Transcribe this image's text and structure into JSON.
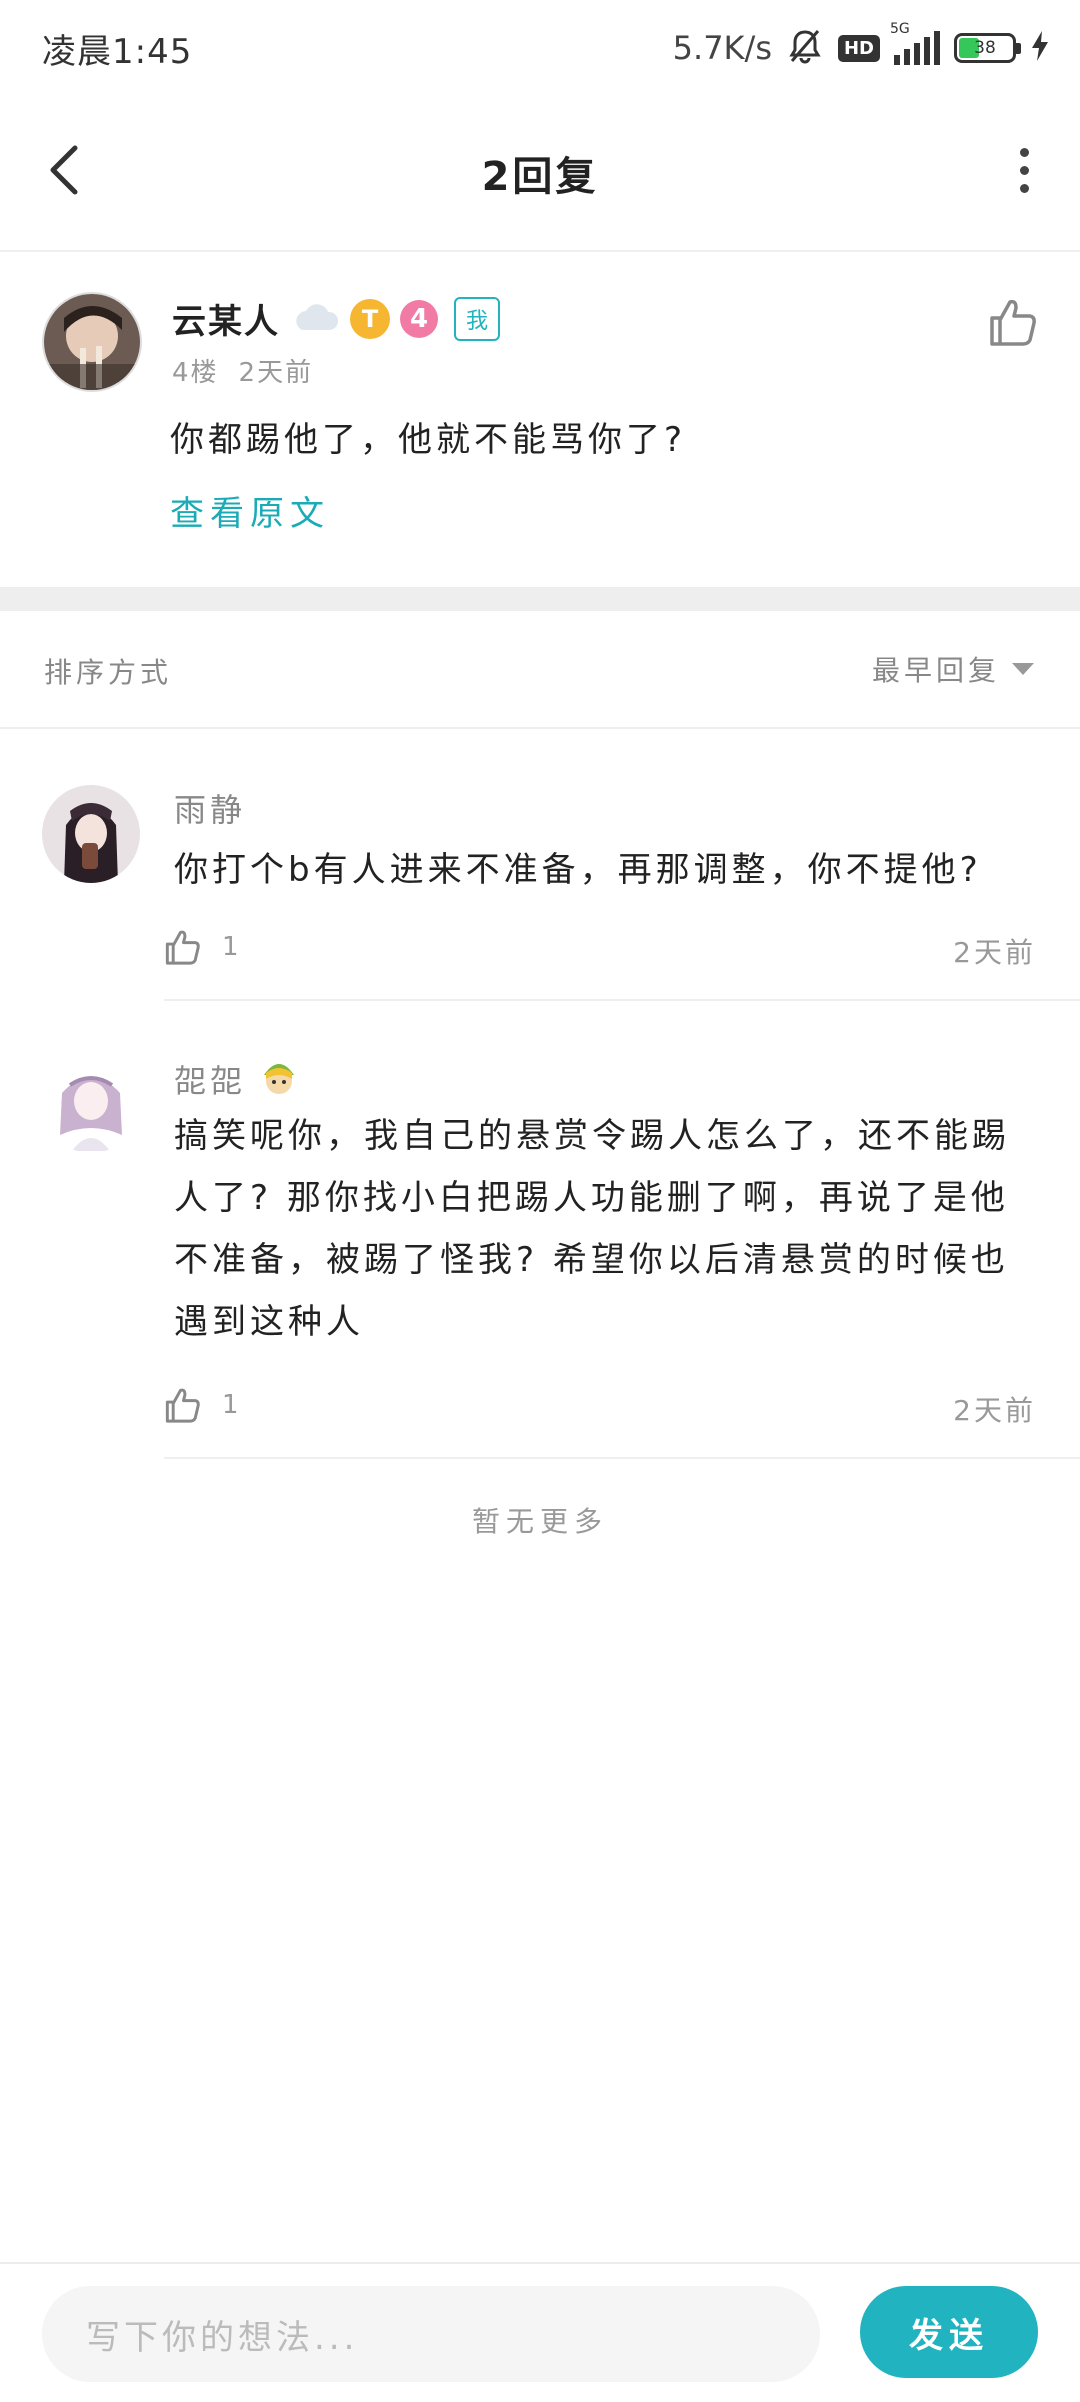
{
  "status_bar": {
    "time": "凌晨1:45",
    "net_speed": "5.7K/s",
    "hd_label": "HD",
    "network": "5G",
    "battery": "38"
  },
  "header": {
    "title": "2回复"
  },
  "original_comment": {
    "author": "云某人",
    "badge_t": "T",
    "level": "4",
    "me_tag": "我",
    "floor": "4楼",
    "time": "2天前",
    "text": "你都踢他了，他就不能骂你了?",
    "view_original": "查看原文"
  },
  "sort": {
    "label": "排序方式",
    "selected": "最早回复"
  },
  "replies": [
    {
      "author": "雨静",
      "text": "你打个b有人进来不准备，再那调整，你不提他?",
      "likes": "1",
      "time": "2天前"
    },
    {
      "author": "㖙㖙",
      "text": "搞笑呢你，我自己的悬赏令踢人怎么了，还不能踢人了? 那你找小白把踢人功能删了啊，再说了是他不准备，被踢了怪我? 希望你以后清悬赏的时候也遇到这种人",
      "likes": "1",
      "time": "2天前"
    }
  ],
  "no_more": "暂无更多",
  "composer": {
    "placeholder": "写下你的想法...",
    "send_label": "发送"
  },
  "colors": {
    "accent": "#21b3bf",
    "link": "#1aabb6"
  }
}
